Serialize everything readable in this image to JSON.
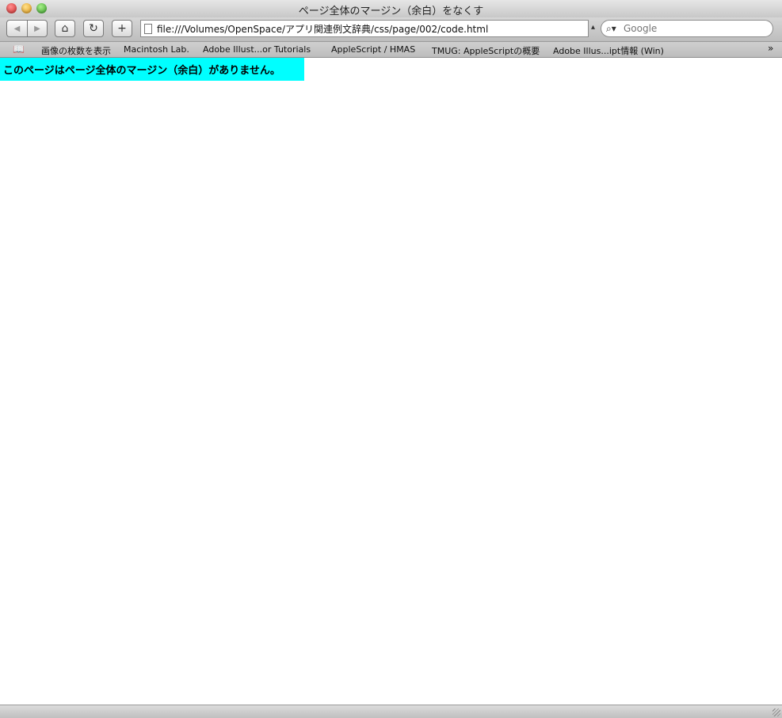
{
  "window": {
    "title": "ページ全体のマージン（余白）をなくす"
  },
  "toolbar": {
    "back_glyph": "◀",
    "forward_glyph": "▶",
    "home_glyph": "⌂",
    "reload_glyph": "↻",
    "add_glyph": "+",
    "address_value": "file:///Volumes/OpenSpace/アプリ関連例文辞典/css/page/002/code.html",
    "search_placeholder": "Google"
  },
  "bookmarks": {
    "items": [
      "画像の枚数を表示",
      "Macintosh Lab.",
      "Adobe Illust...or Tutorials",
      "AppleScript / HMAS",
      "TMUG: AppleScriptの概要",
      "Adobe Illus...ipt情報 (Win)"
    ],
    "overflow_glyph": "»"
  },
  "page": {
    "banner_text": "このページはページ全体のマージン（余白）がありません。",
    "banner_color": "#00ffff"
  }
}
